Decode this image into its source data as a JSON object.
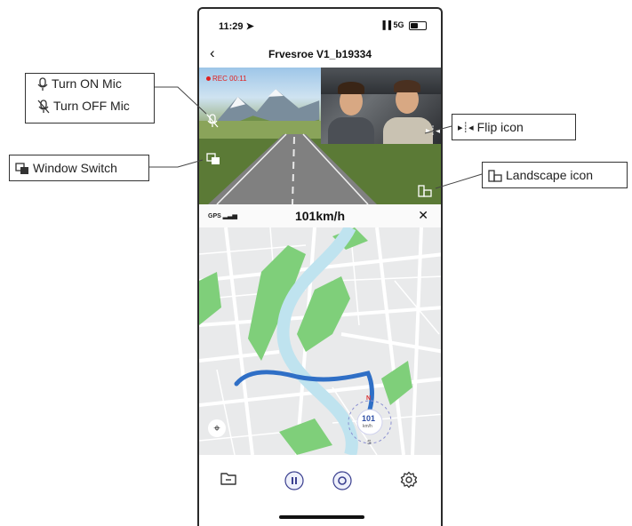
{
  "status_bar": {
    "time": "11:29",
    "network": "5G"
  },
  "nav": {
    "title": "Frvesroe V1_b19334"
  },
  "video": {
    "rec_text": "REC 00:11"
  },
  "speed_bar": {
    "gps_label": "GPS",
    "speed": "101km/h"
  },
  "compass": {
    "north": "N",
    "south": "S",
    "speed_value": "101",
    "speed_unit": "km/h"
  },
  "annotations": {
    "mic_on": "Turn ON Mic",
    "mic_off": "Turn OFF Mic",
    "window_switch": "Window Switch",
    "flip": "Flip icon",
    "landscape": "Landscape icon"
  },
  "colors": {
    "route": "#2f6fc6",
    "rec": "#e02020",
    "park": "#7fcf7a",
    "river": "#bfe3ef"
  }
}
